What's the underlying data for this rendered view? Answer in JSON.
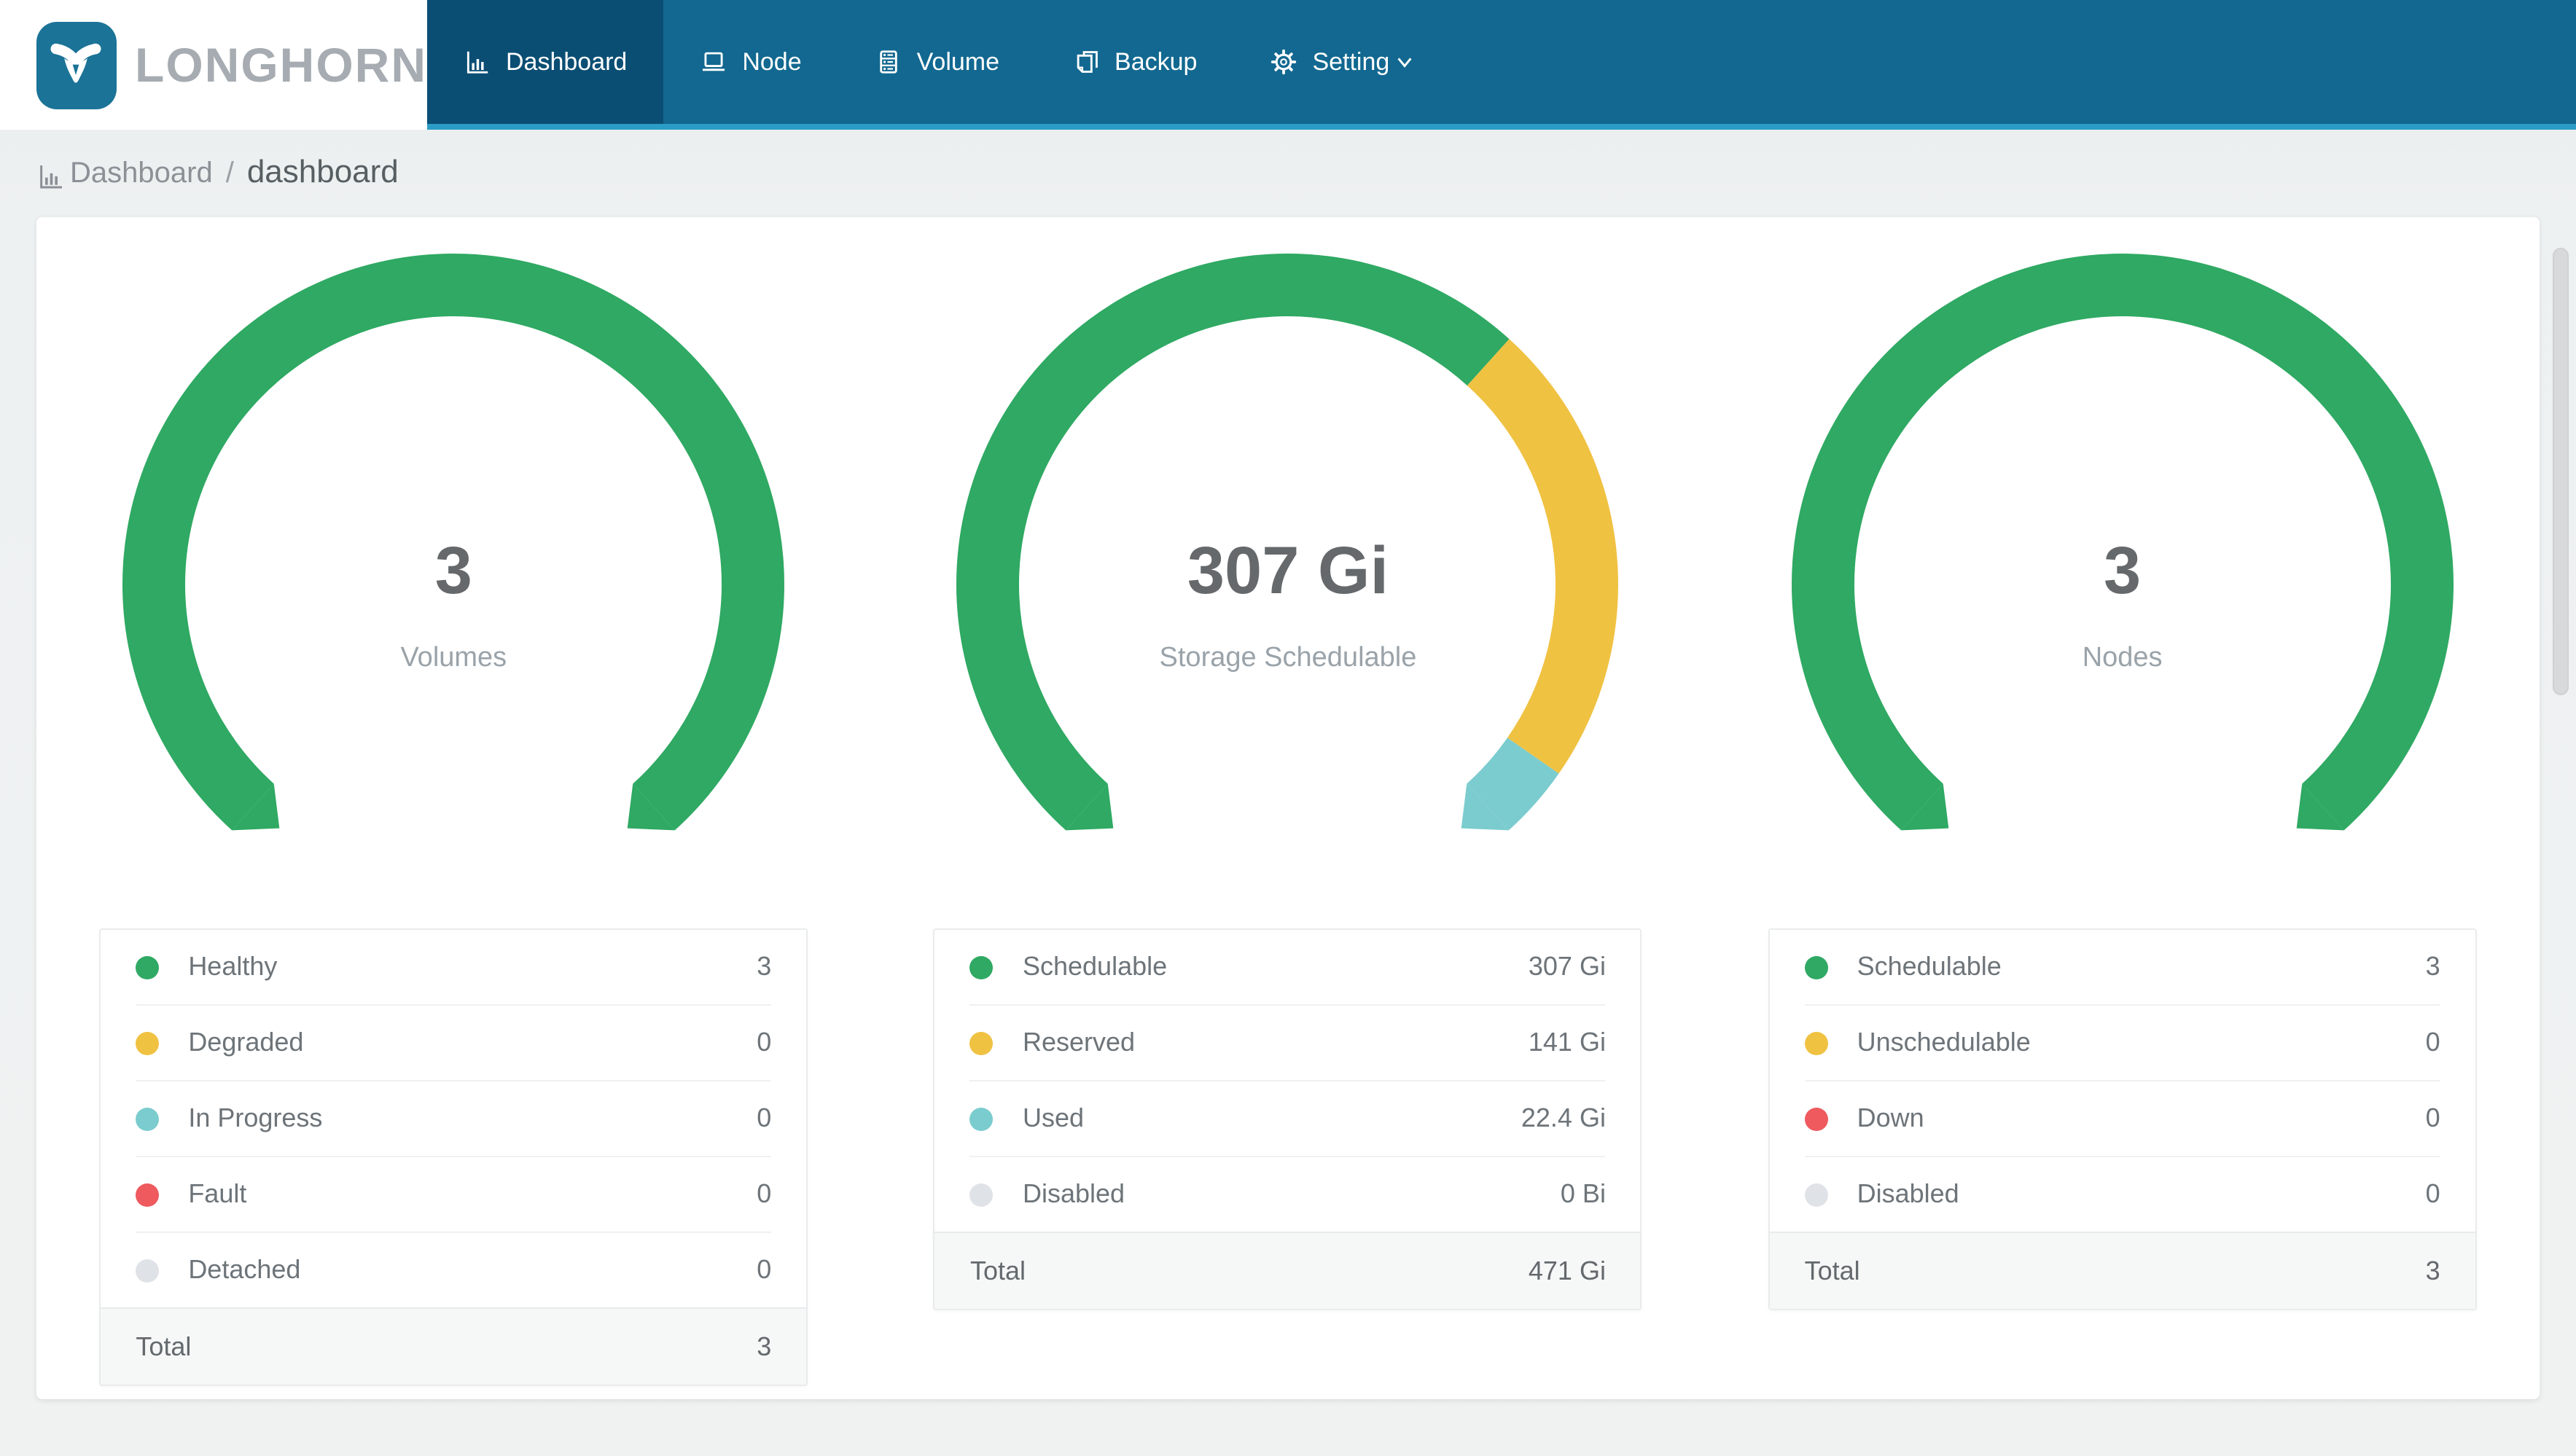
{
  "brand": {
    "logo_text": "LONGHORN"
  },
  "nav": {
    "items": [
      {
        "label": "Dashboard",
        "icon": "bar-chart-icon",
        "active": true
      },
      {
        "label": "Node",
        "icon": "laptop-icon",
        "active": false
      },
      {
        "label": "Volume",
        "icon": "server-stack-icon",
        "active": false
      },
      {
        "label": "Backup",
        "icon": "copy-pages-icon",
        "active": false
      },
      {
        "label": "Setting",
        "icon": "gear-icon",
        "active": false,
        "dropdown": true
      }
    ]
  },
  "breadcrumb": {
    "icon": "bar-chart-icon",
    "root": "Dashboard",
    "separator": "/",
    "current": "dashboard"
  },
  "colors": {
    "nav_bg": "#126890",
    "nav_active": "#0b4e74",
    "nav_strip": "#2a9cc5",
    "logo_blue": "#1b7397",
    "logo_text_gray": "#a6acb1",
    "green": "#2fa963",
    "yellow": "#f0c242",
    "teal": "#7bccce",
    "red": "#ee5a5e",
    "gray": "#dfe3e7",
    "value_text": "#66696b",
    "label_text": "#9aa3a9",
    "page_bg": "#eff1f2"
  },
  "chart_data": [
    {
      "type": "pie",
      "variant": "gauge-donut",
      "title": "Volumes",
      "center_value": "3",
      "center_label": "Volumes",
      "arc": {
        "start_angle": 228,
        "sweep": 276
      },
      "legend": [
        {
          "label": "Healthy",
          "value": 3,
          "display": "3",
          "color": "#2fa963"
        },
        {
          "label": "Degraded",
          "value": 0,
          "display": "0",
          "color": "#f0c242"
        },
        {
          "label": "In Progress",
          "value": 0,
          "display": "0",
          "color": "#7bccce"
        },
        {
          "label": "Fault",
          "value": 0,
          "display": "0",
          "color": "#ee5a5e"
        },
        {
          "label": "Detached",
          "value": 0,
          "display": "0",
          "color": "#dfe3e7"
        }
      ],
      "total": {
        "label": "Total",
        "display": "3"
      }
    },
    {
      "type": "pie",
      "variant": "gauge-donut",
      "title": "Storage Schedulable",
      "center_value": "307 Gi",
      "center_label": "Storage Schedulable",
      "arc": {
        "start_angle": 228,
        "sweep": 276
      },
      "legend": [
        {
          "label": "Schedulable",
          "value": 307,
          "display": "307 Gi",
          "color": "#2fa963"
        },
        {
          "label": "Reserved",
          "value": 141,
          "display": "141 Gi",
          "color": "#f0c242"
        },
        {
          "label": "Used",
          "value": 22.4,
          "display": "22.4 Gi",
          "color": "#7bccce"
        },
        {
          "label": "Disabled",
          "value": 0,
          "display": "0 Bi",
          "color": "#dfe3e7"
        }
      ],
      "total": {
        "label": "Total",
        "display": "471 Gi"
      }
    },
    {
      "type": "pie",
      "variant": "gauge-donut",
      "title": "Nodes",
      "center_value": "3",
      "center_label": "Nodes",
      "arc": {
        "start_angle": 228,
        "sweep": 276
      },
      "legend": [
        {
          "label": "Schedulable",
          "value": 3,
          "display": "3",
          "color": "#2fa963"
        },
        {
          "label": "Unschedulable",
          "value": 0,
          "display": "0",
          "color": "#f0c242"
        },
        {
          "label": "Down",
          "value": 0,
          "display": "0",
          "color": "#ee5a5e"
        },
        {
          "label": "Disabled",
          "value": 0,
          "display": "0",
          "color": "#dfe3e7"
        }
      ],
      "total": {
        "label": "Total",
        "display": "3"
      }
    }
  ]
}
